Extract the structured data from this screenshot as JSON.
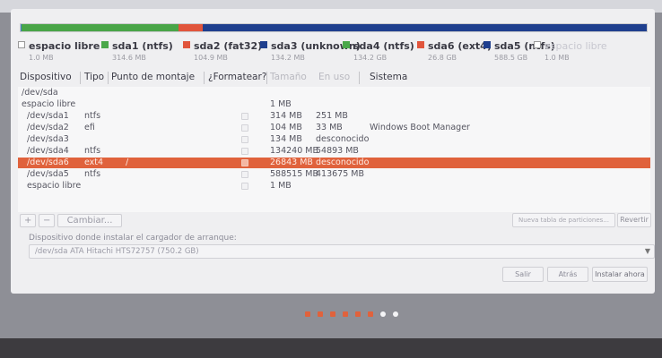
{
  "partition_bar": {
    "segments": [
      {
        "color": "#3f7fc8",
        "share": 0.002
      },
      {
        "color": "#49a548",
        "share": 0.25
      },
      {
        "color": "#e1553c",
        "share": 0.04
      },
      {
        "color": "#1f3f8e",
        "share": 0.71
      }
    ]
  },
  "legend": [
    {
      "name": "espacio libre",
      "size": "1.0 MB",
      "color": "#ffffff",
      "empty": true,
      "faint": false
    },
    {
      "name": "sda1 (ntfs)",
      "size": "314.6 MB",
      "color": "#4aa84a",
      "empty": false,
      "faint": false
    },
    {
      "name": "sda2 (fat32)",
      "size": "104.9 MB",
      "color": "#e1553c",
      "empty": false,
      "faint": false
    },
    {
      "name": "sda3 (unknown)",
      "size": "134.2 MB",
      "color": "#1f3f8e",
      "empty": false,
      "faint": false
    },
    {
      "name": "sda4 (ntfs)",
      "size": "134.2 GB",
      "color": "#4aa84a",
      "empty": false,
      "faint": false
    },
    {
      "name": "sda6 (ext4)",
      "size": "26.8 GB",
      "color": "#e1553c",
      "empty": false,
      "faint": false
    },
    {
      "name": "sda5 (ntfs)",
      "size": "588.5 GB",
      "color": "#1f3f8e",
      "empty": false,
      "faint": false
    },
    {
      "name": "espacio libre",
      "size": "1.0 MB",
      "color": "#ffffff",
      "empty": true,
      "faint": true
    }
  ],
  "table": {
    "headers": {
      "device": "Dispositivo",
      "type": "Tipo",
      "mount": "Punto de montaje",
      "format": "¿Formatear?",
      "size": "Tamaño",
      "used": "En uso",
      "system": "Sistema"
    },
    "rows": [
      {
        "device": "/dev/sda",
        "type": "",
        "mount": "",
        "size": "",
        "used": "",
        "system": "",
        "checkbox": false,
        "selected": false
      },
      {
        "device": "espacio libre",
        "type": "",
        "mount": "",
        "size": "1 MB",
        "used": "",
        "system": "",
        "checkbox": false,
        "selected": false
      },
      {
        "device": "/dev/sda1",
        "type": "ntfs",
        "mount": "",
        "size": "314 MB",
        "used": "251 MB",
        "system": "",
        "checkbox": true,
        "selected": false
      },
      {
        "device": "/dev/sda2",
        "type": "efi",
        "mount": "",
        "size": "104 MB",
        "used": "33 MB",
        "system": "Windows Boot Manager",
        "checkbox": true,
        "selected": false
      },
      {
        "device": "/dev/sda3",
        "type": "",
        "mount": "",
        "size": "134 MB",
        "used": "desconocido",
        "system": "",
        "checkbox": true,
        "selected": false
      },
      {
        "device": "/dev/sda4",
        "type": "ntfs",
        "mount": "",
        "size": "134240 MB",
        "used": "54893 MB",
        "system": "",
        "checkbox": true,
        "selected": false
      },
      {
        "device": "/dev/sda6",
        "type": "ext4",
        "mount": "/",
        "size": "26843 MB",
        "used": "desconocido",
        "system": "",
        "checkbox": true,
        "selected": true
      },
      {
        "device": "/dev/sda5",
        "type": "ntfs",
        "mount": "",
        "size": "588515 MB",
        "used": "413675 MB",
        "system": "",
        "checkbox": true,
        "selected": false
      },
      {
        "device": "espacio libre",
        "type": "",
        "mount": "",
        "size": "1 MB",
        "used": "",
        "system": "",
        "checkbox": true,
        "selected": false
      }
    ]
  },
  "buttons": {
    "add": "+",
    "remove": "−",
    "change": "Cambiar...",
    "new_table": "Nueva tabla de particiones...",
    "revert": "Revertir"
  },
  "bootloader": {
    "label": "Dispositivo donde instalar el cargador de arranque:",
    "value": "/dev/sda   ATA Hitachi HTS72757 (750.2 GB)"
  },
  "actions": {
    "quit": "Salir",
    "back": "Atrás",
    "install": "Instalar ahora"
  },
  "progress": {
    "total_steps": 8,
    "completed_steps": 6
  },
  "colors": {
    "accent": "#e0623c"
  }
}
